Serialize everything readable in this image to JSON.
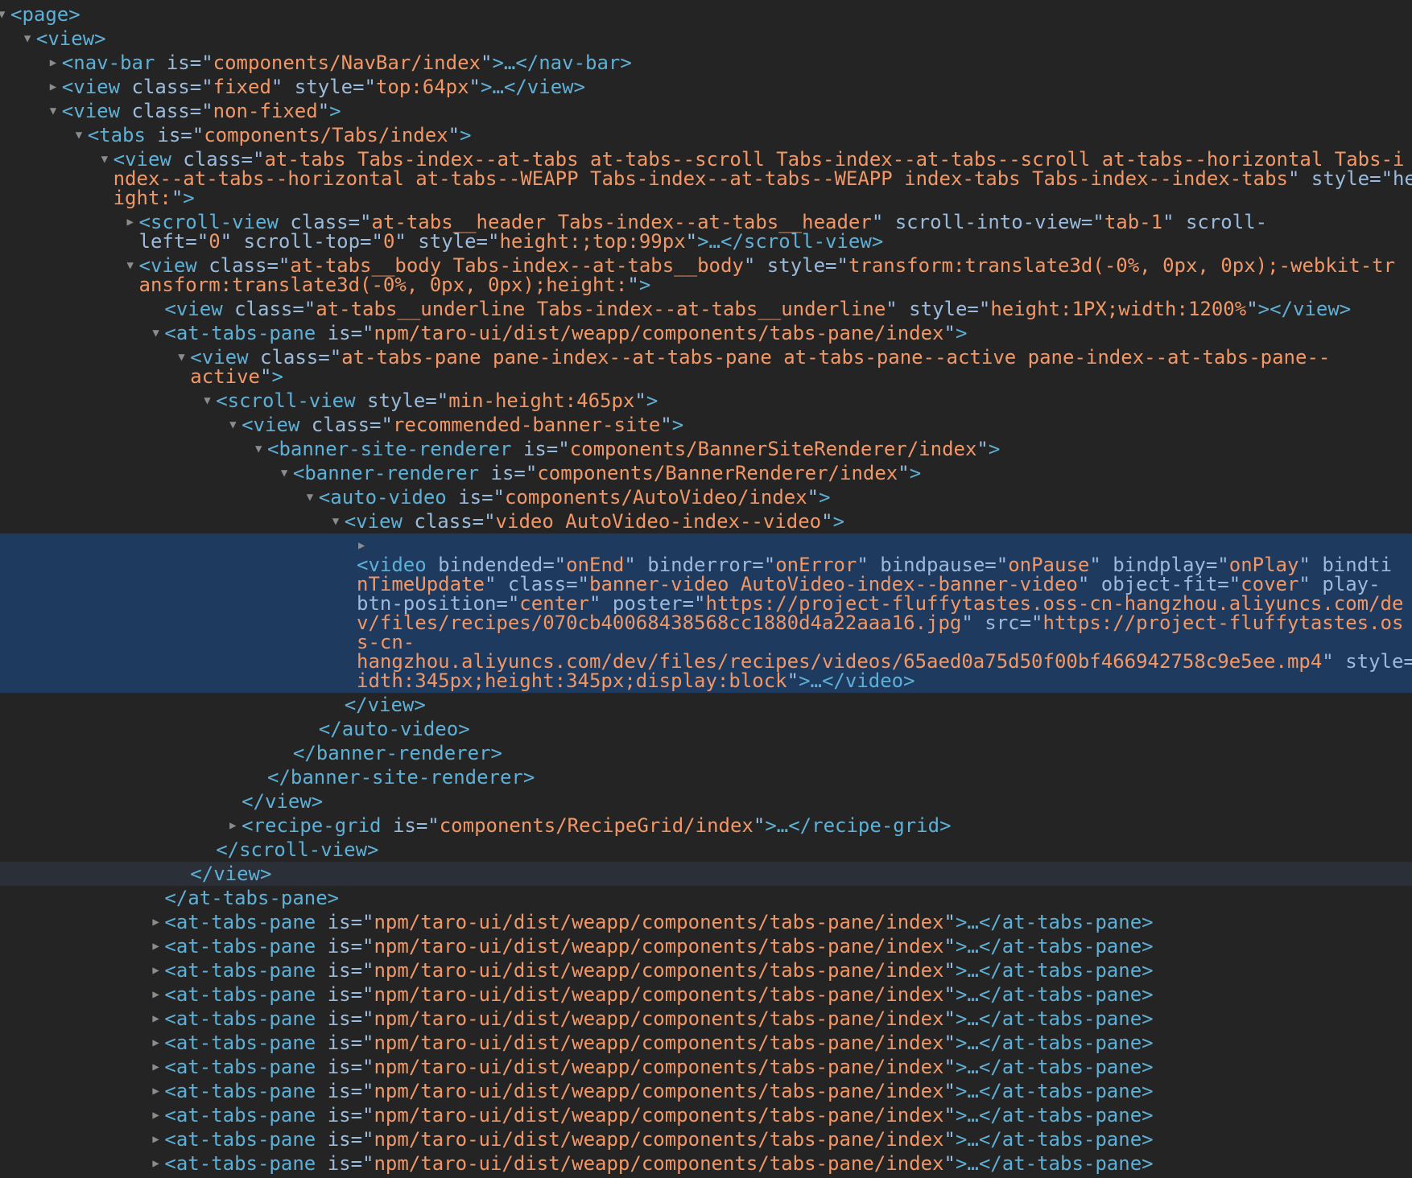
{
  "colors": {
    "background": "#242424",
    "tag": "#5db0d7",
    "attr": "#9bbbdc",
    "value": "#f29766",
    "selected": "#1e3a5f"
  },
  "arrow_icons": {
    "expanded": "▼",
    "collapsed": "▶"
  },
  "rows": [
    {
      "depth": 0,
      "arrow": "expanded",
      "lines": [
        [
          [
            "t",
            "<page>"
          ]
        ]
      ]
    },
    {
      "depth": 1,
      "arrow": "expanded",
      "lines": [
        [
          [
            "t",
            "<view>"
          ]
        ]
      ]
    },
    {
      "depth": 2,
      "arrow": "collapsed",
      "lines": [
        [
          [
            "t",
            "<nav-bar "
          ],
          [
            "a",
            "is=\""
          ],
          [
            "v",
            "components/NavBar/index"
          ],
          [
            "a",
            "\""
          ],
          [
            "t",
            ">…</nav-bar>"
          ]
        ]
      ]
    },
    {
      "depth": 2,
      "arrow": "collapsed",
      "lines": [
        [
          [
            "t",
            "<view "
          ],
          [
            "a",
            "class=\""
          ],
          [
            "v",
            "fixed"
          ],
          [
            "a",
            "\" style=\""
          ],
          [
            "v",
            "top:64px"
          ],
          [
            "a",
            "\""
          ],
          [
            "t",
            ">…</view>"
          ]
        ]
      ]
    },
    {
      "depth": 2,
      "arrow": "expanded",
      "lines": [
        [
          [
            "t",
            "<view "
          ],
          [
            "a",
            "class=\""
          ],
          [
            "v",
            "non-fixed"
          ],
          [
            "a",
            "\""
          ],
          [
            "t",
            ">"
          ]
        ]
      ]
    },
    {
      "depth": 3,
      "arrow": "expanded",
      "lines": [
        [
          [
            "t",
            "<tabs "
          ],
          [
            "a",
            "is=\""
          ],
          [
            "v",
            "components/Tabs/index"
          ],
          [
            "a",
            "\""
          ],
          [
            "t",
            ">"
          ]
        ]
      ]
    },
    {
      "depth": 4,
      "arrow": "expanded",
      "lines": [
        [
          [
            "t",
            "<view "
          ],
          [
            "a",
            "class=\""
          ],
          [
            "v",
            "at-tabs Tabs-index--at-tabs at-tabs--scroll Tabs-index--at-tabs--scroll at-tabs--horizontal Tabs-i"
          ]
        ],
        [
          [
            "v",
            "ndex--at-tabs--horizontal at-tabs--WEAPP Tabs-index--at-tabs--WEAPP index-tabs Tabs-index--index-tabs"
          ],
          [
            "a",
            "\" style=\"he"
          ]
        ],
        [
          [
            "v",
            "ight:"
          ],
          [
            "a",
            "\""
          ],
          [
            "t",
            ">"
          ]
        ]
      ]
    },
    {
      "depth": 5,
      "arrow": "collapsed",
      "lines": [
        [
          [
            "t",
            "<scroll-view "
          ],
          [
            "a",
            "class=\""
          ],
          [
            "v",
            "at-tabs__header Tabs-index--at-tabs__header"
          ],
          [
            "a",
            "\" scroll-into-view=\""
          ],
          [
            "v",
            "tab-1"
          ],
          [
            "a",
            "\" scroll-"
          ]
        ],
        [
          [
            "a",
            "left=\""
          ],
          [
            "v",
            "0"
          ],
          [
            "a",
            "\" scroll-top=\""
          ],
          [
            "v",
            "0"
          ],
          [
            "a",
            "\" style=\""
          ],
          [
            "v",
            "height:;top:99px"
          ],
          [
            "a",
            "\""
          ],
          [
            "t",
            ">…</scroll-view>"
          ]
        ]
      ]
    },
    {
      "depth": 5,
      "arrow": "expanded",
      "lines": [
        [
          [
            "t",
            "<view "
          ],
          [
            "a",
            "class=\""
          ],
          [
            "v",
            "at-tabs__body Tabs-index--at-tabs__body"
          ],
          [
            "a",
            "\" style=\""
          ],
          [
            "v",
            "transform:translate3d(-0%, 0px, 0px);-webkit-tr"
          ]
        ],
        [
          [
            "v",
            "ansform:translate3d(-0%, 0px, 0px);height:"
          ],
          [
            "a",
            "\""
          ],
          [
            "t",
            ">"
          ]
        ]
      ]
    },
    {
      "depth": 6,
      "arrow": "none",
      "lines": [
        [
          [
            "t",
            "<view "
          ],
          [
            "a",
            "class=\""
          ],
          [
            "v",
            "at-tabs__underline Tabs-index--at-tabs__underline"
          ],
          [
            "a",
            "\" style=\""
          ],
          [
            "v",
            "height:1PX;width:1200%"
          ],
          [
            "a",
            "\""
          ],
          [
            "t",
            "></view>"
          ]
        ]
      ]
    },
    {
      "depth": 6,
      "arrow": "expanded",
      "lines": [
        [
          [
            "t",
            "<at-tabs-pane "
          ],
          [
            "a",
            "is=\""
          ],
          [
            "v",
            "npm/taro-ui/dist/weapp/components/tabs-pane/index"
          ],
          [
            "a",
            "\""
          ],
          [
            "t",
            ">"
          ]
        ]
      ]
    },
    {
      "depth": 7,
      "arrow": "expanded",
      "lines": [
        [
          [
            "t",
            "<view "
          ],
          [
            "a",
            "class=\""
          ],
          [
            "v",
            "at-tabs-pane pane-index--at-tabs-pane at-tabs-pane--active pane-index--at-tabs-pane--"
          ]
        ],
        [
          [
            "v",
            "active"
          ],
          [
            "a",
            "\""
          ],
          [
            "t",
            ">"
          ]
        ]
      ]
    },
    {
      "depth": 8,
      "arrow": "expanded",
      "lines": [
        [
          [
            "t",
            "<scroll-view "
          ],
          [
            "a",
            "style=\""
          ],
          [
            "v",
            "min-height:465px"
          ],
          [
            "a",
            "\""
          ],
          [
            "t",
            ">"
          ]
        ]
      ]
    },
    {
      "depth": 9,
      "arrow": "expanded",
      "lines": [
        [
          [
            "t",
            "<view "
          ],
          [
            "a",
            "class=\""
          ],
          [
            "v",
            "recommended-banner-site"
          ],
          [
            "a",
            "\""
          ],
          [
            "t",
            ">"
          ]
        ]
      ]
    },
    {
      "depth": 10,
      "arrow": "expanded",
      "lines": [
        [
          [
            "t",
            "<banner-site-renderer "
          ],
          [
            "a",
            "is=\""
          ],
          [
            "v",
            "components/BannerSiteRenderer/index"
          ],
          [
            "a",
            "\""
          ],
          [
            "t",
            ">"
          ]
        ]
      ]
    },
    {
      "depth": 11,
      "arrow": "expanded",
      "lines": [
        [
          [
            "t",
            "<banner-renderer "
          ],
          [
            "a",
            "is=\""
          ],
          [
            "v",
            "components/BannerRenderer/index"
          ],
          [
            "a",
            "\""
          ],
          [
            "t",
            ">"
          ]
        ]
      ]
    },
    {
      "depth": 12,
      "arrow": "expanded",
      "lines": [
        [
          [
            "t",
            "<auto-video "
          ],
          [
            "a",
            "is=\""
          ],
          [
            "v",
            "components/AutoVideo/index"
          ],
          [
            "a",
            "\""
          ],
          [
            "t",
            ">"
          ]
        ]
      ]
    },
    {
      "depth": 13,
      "arrow": "expanded",
      "lines": [
        [
          [
            "t",
            "<view "
          ],
          [
            "a",
            "class=\""
          ],
          [
            "v",
            "video AutoVideo-index--video"
          ],
          [
            "a",
            "\""
          ],
          [
            "t",
            ">"
          ]
        ]
      ]
    },
    {
      "depth": 14,
      "arrow": "collapsed",
      "selected": true,
      "lines": [
        [],
        [
          [
            "t",
            "<video "
          ],
          [
            "a",
            "bindended=\""
          ],
          [
            "v",
            "onEnd"
          ],
          [
            "a",
            "\" binderror=\""
          ],
          [
            "v",
            "onError"
          ],
          [
            "a",
            "\" bindpause=\""
          ],
          [
            "v",
            "onPause"
          ],
          [
            "a",
            "\" bindplay=\""
          ],
          [
            "v",
            "onPlay"
          ],
          [
            "a",
            "\" bindti"
          ]
        ],
        [
          [
            "v",
            "nTimeUpdate"
          ],
          [
            "a",
            "\" class=\""
          ],
          [
            "v",
            "banner-video AutoVideo-index--banner-video"
          ],
          [
            "a",
            "\" object-fit=\""
          ],
          [
            "v",
            "cover"
          ],
          [
            "a",
            "\" play-"
          ]
        ],
        [
          [
            "a",
            "btn-position=\""
          ],
          [
            "v",
            "center"
          ],
          [
            "a",
            "\" poster=\""
          ],
          [
            "v",
            "https://project-fluffytastes.oss-cn-hangzhou.aliyuncs.com/de"
          ]
        ],
        [
          [
            "v",
            "v/files/recipes/070cb40068438568cc1880d4a22aaa16.jpg"
          ],
          [
            "a",
            "\" src=\""
          ],
          [
            "v",
            "https://project-fluffytastes.os"
          ]
        ],
        [
          [
            "v",
            "s-cn-"
          ]
        ],
        [
          [
            "v",
            "hangzhou.aliyuncs.com/dev/files/recipes/videos/65aed0a75d50f00bf466942758c9e5ee.mp4"
          ],
          [
            "a",
            "\" style=\"w"
          ]
        ],
        [
          [
            "v",
            "idth:345px;height:345px;display:block"
          ],
          [
            "a",
            "\""
          ],
          [
            "t",
            ">…</video>"
          ]
        ]
      ]
    },
    {
      "depth": 13,
      "arrow": "none",
      "lines": [
        [
          [
            "t",
            "</view>"
          ]
        ]
      ]
    },
    {
      "depth": 12,
      "arrow": "none",
      "lines": [
        [
          [
            "t",
            "</auto-video>"
          ]
        ]
      ]
    },
    {
      "depth": 11,
      "arrow": "none",
      "lines": [
        [
          [
            "t",
            "</banner-renderer>"
          ]
        ]
      ]
    },
    {
      "depth": 10,
      "arrow": "none",
      "lines": [
        [
          [
            "t",
            "</banner-site-renderer>"
          ]
        ]
      ]
    },
    {
      "depth": 9,
      "arrow": "none",
      "lines": [
        [
          [
            "t",
            "</view>"
          ]
        ]
      ]
    },
    {
      "depth": 9,
      "arrow": "collapsed",
      "lines": [
        [
          [
            "t",
            "<recipe-grid "
          ],
          [
            "a",
            "is=\""
          ],
          [
            "v",
            "components/RecipeGrid/index"
          ],
          [
            "a",
            "\""
          ],
          [
            "t",
            ">…</recipe-grid>"
          ]
        ]
      ]
    },
    {
      "depth": 8,
      "arrow": "none",
      "lines": [
        [
          [
            "t",
            "</scroll-view>"
          ]
        ]
      ]
    },
    {
      "depth": 7,
      "arrow": "none",
      "hover": true,
      "lines": [
        [
          [
            "t",
            "</view>"
          ]
        ]
      ]
    },
    {
      "depth": 6,
      "arrow": "none",
      "lines": [
        [
          [
            "t",
            "</at-tabs-pane>"
          ]
        ]
      ]
    },
    {
      "depth": 6,
      "arrow": "collapsed",
      "lines": [
        [
          [
            "t",
            "<at-tabs-pane "
          ],
          [
            "a",
            "is=\""
          ],
          [
            "v",
            "npm/taro-ui/dist/weapp/components/tabs-pane/index"
          ],
          [
            "a",
            "\""
          ],
          [
            "t",
            ">…</at-tabs-pane>"
          ]
        ]
      ]
    },
    {
      "depth": 6,
      "arrow": "collapsed",
      "lines": [
        [
          [
            "t",
            "<at-tabs-pane "
          ],
          [
            "a",
            "is=\""
          ],
          [
            "v",
            "npm/taro-ui/dist/weapp/components/tabs-pane/index"
          ],
          [
            "a",
            "\""
          ],
          [
            "t",
            ">…</at-tabs-pane>"
          ]
        ]
      ]
    },
    {
      "depth": 6,
      "arrow": "collapsed",
      "lines": [
        [
          [
            "t",
            "<at-tabs-pane "
          ],
          [
            "a",
            "is=\""
          ],
          [
            "v",
            "npm/taro-ui/dist/weapp/components/tabs-pane/index"
          ],
          [
            "a",
            "\""
          ],
          [
            "t",
            ">…</at-tabs-pane>"
          ]
        ]
      ]
    },
    {
      "depth": 6,
      "arrow": "collapsed",
      "lines": [
        [
          [
            "t",
            "<at-tabs-pane "
          ],
          [
            "a",
            "is=\""
          ],
          [
            "v",
            "npm/taro-ui/dist/weapp/components/tabs-pane/index"
          ],
          [
            "a",
            "\""
          ],
          [
            "t",
            ">…</at-tabs-pane>"
          ]
        ]
      ]
    },
    {
      "depth": 6,
      "arrow": "collapsed",
      "lines": [
        [
          [
            "t",
            "<at-tabs-pane "
          ],
          [
            "a",
            "is=\""
          ],
          [
            "v",
            "npm/taro-ui/dist/weapp/components/tabs-pane/index"
          ],
          [
            "a",
            "\""
          ],
          [
            "t",
            ">…</at-tabs-pane>"
          ]
        ]
      ]
    },
    {
      "depth": 6,
      "arrow": "collapsed",
      "lines": [
        [
          [
            "t",
            "<at-tabs-pane "
          ],
          [
            "a",
            "is=\""
          ],
          [
            "v",
            "npm/taro-ui/dist/weapp/components/tabs-pane/index"
          ],
          [
            "a",
            "\""
          ],
          [
            "t",
            ">…</at-tabs-pane>"
          ]
        ]
      ]
    },
    {
      "depth": 6,
      "arrow": "collapsed",
      "lines": [
        [
          [
            "t",
            "<at-tabs-pane "
          ],
          [
            "a",
            "is=\""
          ],
          [
            "v",
            "npm/taro-ui/dist/weapp/components/tabs-pane/index"
          ],
          [
            "a",
            "\""
          ],
          [
            "t",
            ">…</at-tabs-pane>"
          ]
        ]
      ]
    },
    {
      "depth": 6,
      "arrow": "collapsed",
      "lines": [
        [
          [
            "t",
            "<at-tabs-pane "
          ],
          [
            "a",
            "is=\""
          ],
          [
            "v",
            "npm/taro-ui/dist/weapp/components/tabs-pane/index"
          ],
          [
            "a",
            "\""
          ],
          [
            "t",
            ">…</at-tabs-pane>"
          ]
        ]
      ]
    },
    {
      "depth": 6,
      "arrow": "collapsed",
      "lines": [
        [
          [
            "t",
            "<at-tabs-pane "
          ],
          [
            "a",
            "is=\""
          ],
          [
            "v",
            "npm/taro-ui/dist/weapp/components/tabs-pane/index"
          ],
          [
            "a",
            "\""
          ],
          [
            "t",
            ">…</at-tabs-pane>"
          ]
        ]
      ]
    },
    {
      "depth": 6,
      "arrow": "collapsed",
      "lines": [
        [
          [
            "t",
            "<at-tabs-pane "
          ],
          [
            "a",
            "is=\""
          ],
          [
            "v",
            "npm/taro-ui/dist/weapp/components/tabs-pane/index"
          ],
          [
            "a",
            "\""
          ],
          [
            "t",
            ">…</at-tabs-pane>"
          ]
        ]
      ]
    },
    {
      "depth": 6,
      "arrow": "collapsed",
      "lines": [
        [
          [
            "t",
            "<at-tabs-pane "
          ],
          [
            "a",
            "is=\""
          ],
          [
            "v",
            "npm/taro-ui/dist/weapp/components/tabs-pane/index"
          ],
          [
            "a",
            "\""
          ],
          [
            "t",
            ">…</at-tabs-pane>"
          ]
        ]
      ]
    }
  ]
}
